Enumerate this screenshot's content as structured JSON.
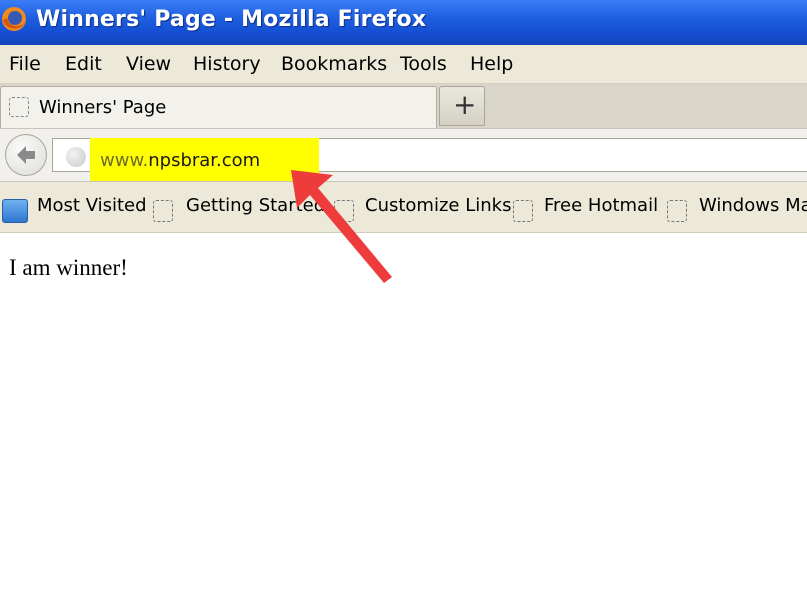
{
  "window": {
    "title": "Winners' Page - Mozilla Firefox"
  },
  "menu": [
    "File",
    "Edit",
    "View",
    "History",
    "Bookmarks",
    "Tools",
    "Help"
  ],
  "tab": {
    "label": "Winners' Page",
    "new_tab_label": "+"
  },
  "address": {
    "prefix": "www.",
    "domain": "npsbrar.com"
  },
  "bookmarks": [
    "Most Visited",
    "Getting Started",
    "Customize Links",
    "Free Hotmail",
    "Windows Ma"
  ],
  "page": {
    "text": "I am winner!"
  },
  "colors": {
    "highlight": "#ffff00",
    "arrow": "#ee3b3b",
    "titlebar": "#1e5fe0"
  }
}
